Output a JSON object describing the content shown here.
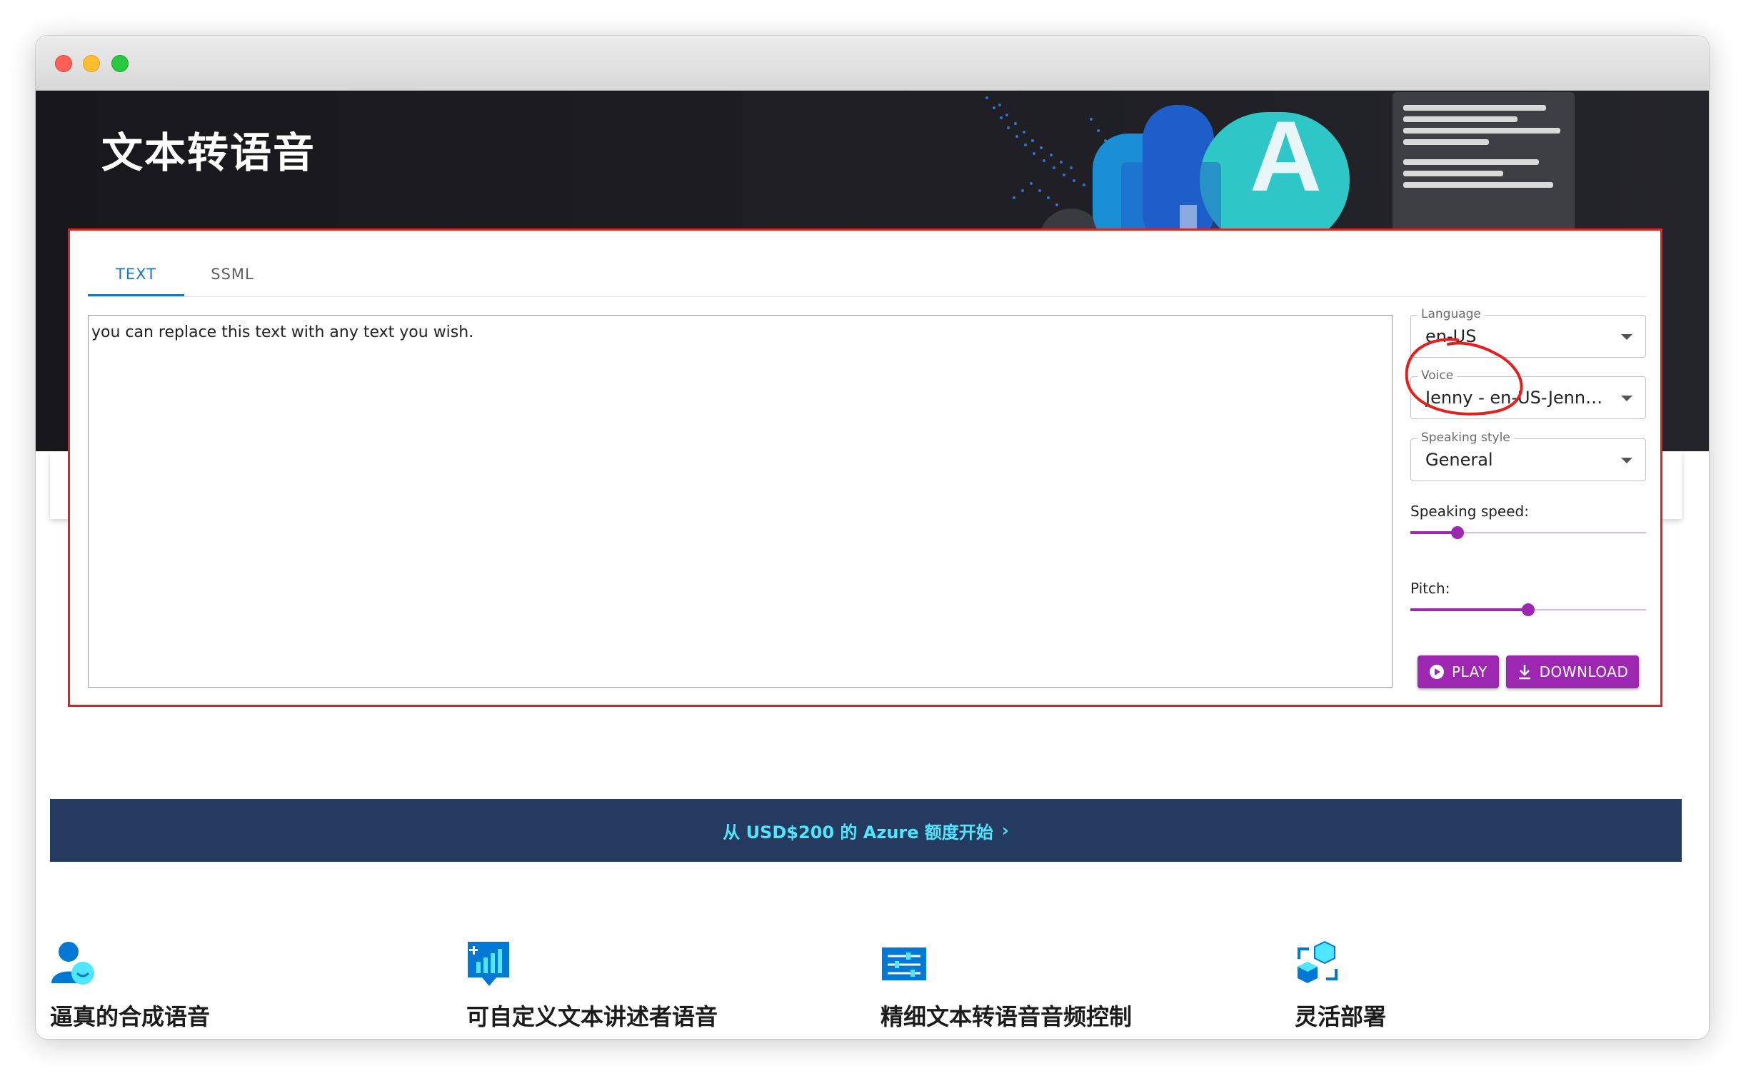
{
  "window": {
    "controls": [
      "close",
      "minimize",
      "zoom"
    ]
  },
  "hero": {
    "title": "文本转语音",
    "art_letter": "A"
  },
  "tabs": [
    {
      "label": "TEXT",
      "active": true
    },
    {
      "label": "SSML",
      "active": false
    }
  ],
  "editor": {
    "text": "you can replace this text with any text you wish."
  },
  "settings": {
    "language": {
      "label": "Language",
      "value": "en-US"
    },
    "voice": {
      "label": "Voice",
      "value": "Jenny - en-US-Jenny…"
    },
    "style": {
      "label": "Speaking style",
      "value": "General"
    },
    "speed": {
      "label": "Speaking speed:",
      "fraction": 0.2
    },
    "pitch": {
      "label": "Pitch:",
      "fraction": 0.5
    }
  },
  "buttons": {
    "play": "PLAY",
    "download": "DOWNLOAD"
  },
  "banner": {
    "text": "从 USD$200 的 Azure 额度开始",
    "chevron": "›"
  },
  "features": [
    {
      "title": "逼真的合成语音",
      "icon": "person-smile-icon"
    },
    {
      "title": "可自定义文本讲述者语音",
      "icon": "chart-speech-icon"
    },
    {
      "title": "精细文本转语音音频控制",
      "icon": "sliders-icon"
    },
    {
      "title": "灵活部署",
      "icon": "cubes-icon"
    }
  ],
  "colors": {
    "accent": "#9c27b0",
    "tab_active": "#1a74c9",
    "highlight_box": "#e4201c",
    "banner_bg": "#243a5e",
    "banner_link": "#50e6ff",
    "hero_bg": "#1c1c21"
  }
}
